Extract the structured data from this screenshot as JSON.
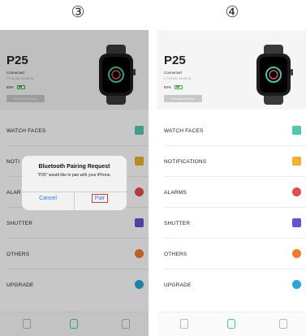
{
  "steps": {
    "left": "③",
    "right": "④"
  },
  "device": {
    "name": "P25",
    "status": "Connected",
    "mac": "F7:41:DC:16:08:31",
    "battery": "60%",
    "battery_level": 0.6,
    "remove_label": "Remove Device"
  },
  "menu": [
    {
      "label": "WATCH FACES",
      "icon": "watch-face-icon",
      "color": "#4ec9b0"
    },
    {
      "label": "NOTIFICATIONS",
      "icon": "notification-icon",
      "color": "#f0b22e"
    },
    {
      "label": "ALARMS",
      "icon": "alarm-icon",
      "color": "#e64c4c"
    },
    {
      "label": "SHUTTER",
      "icon": "camera-icon",
      "color": "#6c4fd1"
    },
    {
      "label": "OTHERS",
      "icon": "settings-icon",
      "color": "#f07a2c"
    },
    {
      "label": "UPGRADE",
      "icon": "upgrade-icon",
      "color": "#2aa6d8"
    }
  ],
  "menu_left_truncated": {
    "notifications": "NOTI",
    "alarms": "ALAR"
  },
  "dialog": {
    "title": "Bluetooth Pairing Request",
    "message": "\"P25\" would like to pair with your iPhone.",
    "cancel": "Cancel",
    "pair": "Pair"
  },
  "tabbar": {
    "tabs": [
      "calendar-icon",
      "watch-icon",
      "profile-icon"
    ],
    "active_color": "#3cc9a8"
  }
}
